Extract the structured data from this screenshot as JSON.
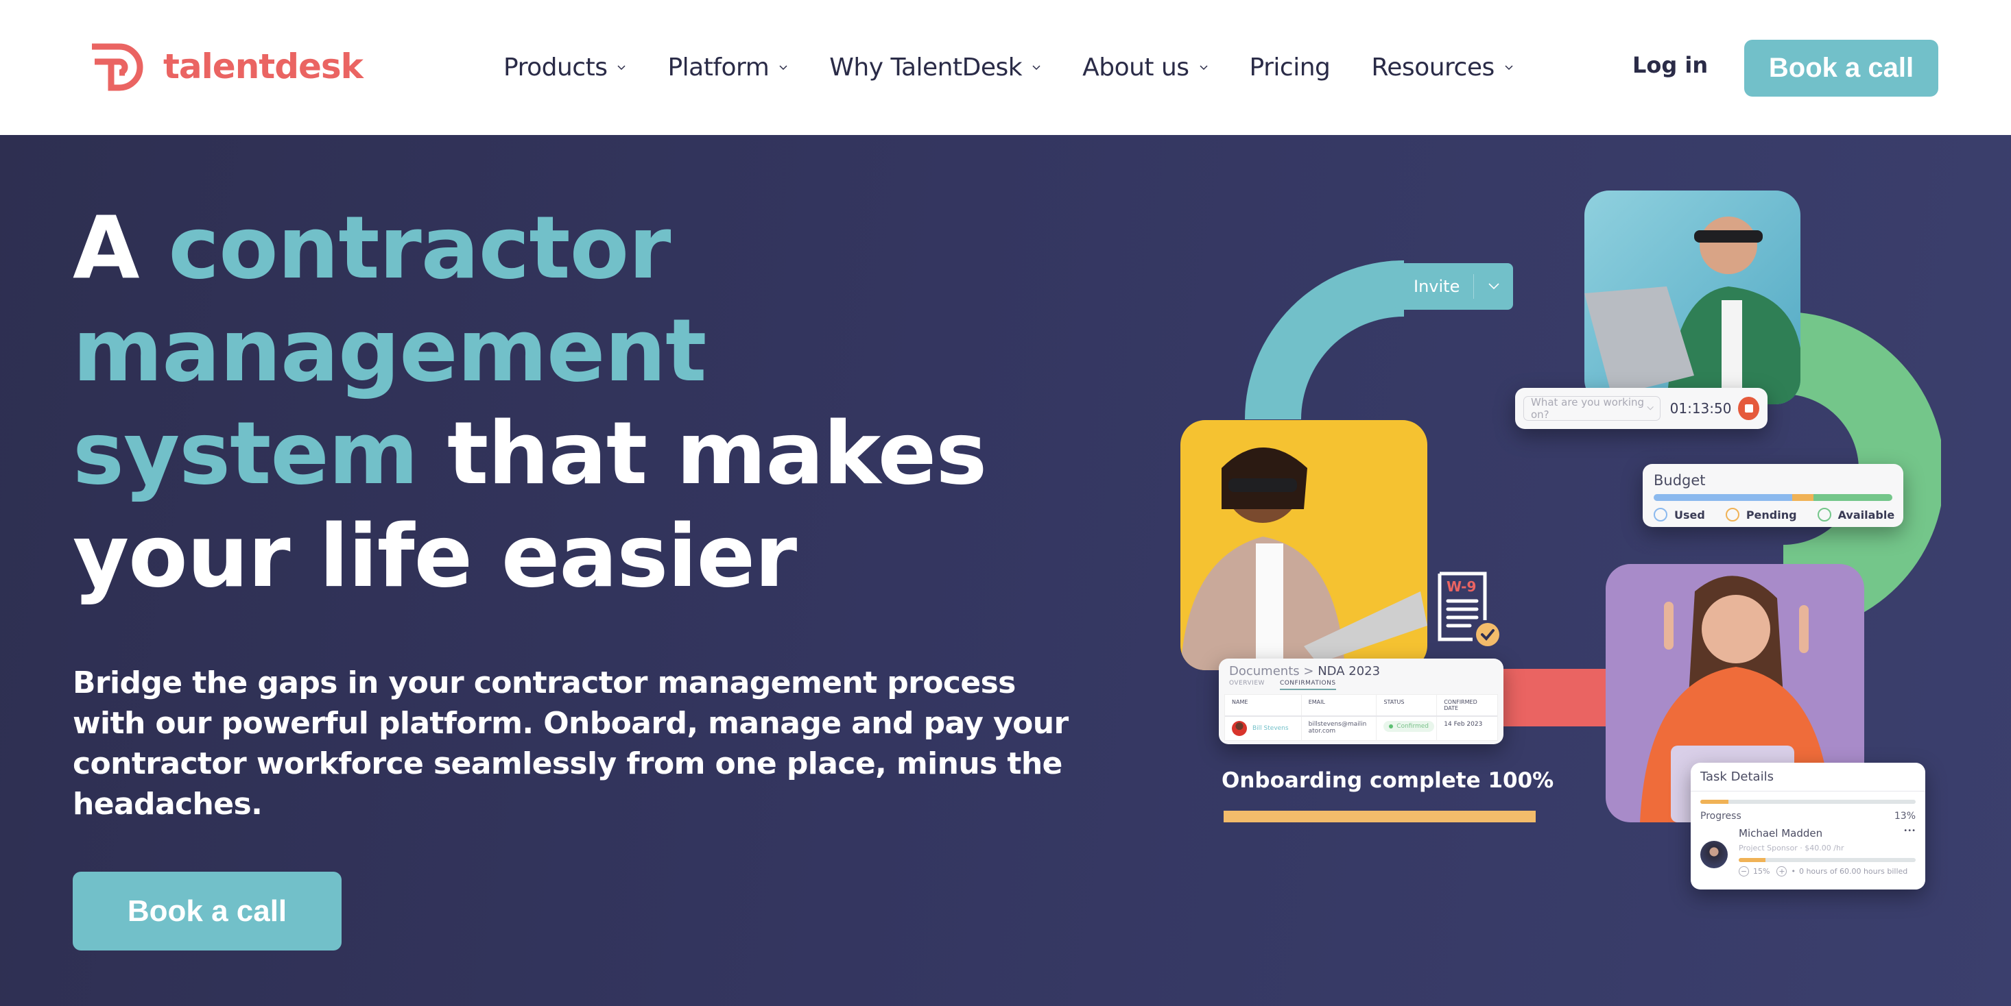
{
  "nav": {
    "logo_text": "talentdesk",
    "menu": [
      {
        "label": "Products",
        "has_dropdown": true
      },
      {
        "label": "Platform",
        "has_dropdown": true
      },
      {
        "label": "Why TalentDesk",
        "has_dropdown": true
      },
      {
        "label": "About us",
        "has_dropdown": true
      },
      {
        "label": "Pricing",
        "has_dropdown": false
      },
      {
        "label": "Resources",
        "has_dropdown": true
      }
    ],
    "login_label": "Log in",
    "cta_label": "Book a call"
  },
  "hero": {
    "headline_part1": "A ",
    "headline_accent": "contractor management system",
    "headline_part2": " that makes your life easier",
    "subheadline": "Bridge the gaps in your contractor management process with our powerful platform. Onboard, manage and pay your contractor workforce seamlessly from one place, minus the headaches.",
    "cta_label": "Book a call"
  },
  "illustration": {
    "invite_button": {
      "label": "Invite"
    },
    "timer": {
      "placeholder": "What are you working on?",
      "time": "01:13:50"
    },
    "budget": {
      "title": "Budget",
      "segments": [
        {
          "label": "Used",
          "fraction": 0.58,
          "color": "#8bb9ee"
        },
        {
          "label": "Pending",
          "fraction": 0.09,
          "color": "#f0b256"
        },
        {
          "label": "Available",
          "fraction": 0.33,
          "color": "#74c68a"
        }
      ]
    },
    "w9_label": "W-9",
    "documents": {
      "breadcrumb_parent": "Documents",
      "breadcrumb_sep": ">",
      "breadcrumb_current": "NDA 2023",
      "tabs": [
        {
          "label": "OVERVIEW",
          "active": false
        },
        {
          "label": "CONFIRMATIONS",
          "active": true
        }
      ],
      "columns": [
        "NAME",
        "EMAIL",
        "STATUS",
        "CONFIRMED DATE"
      ],
      "rows": [
        {
          "name": "Bill Stevens",
          "email": "billstevens@mailinator.com",
          "status": "Confirmed",
          "date": "14 Feb 2023"
        }
      ]
    },
    "onboarding": {
      "label": "Onboarding complete 100%",
      "progress_percent": 100
    },
    "task": {
      "title": "Task Details",
      "progress_label": "Progress",
      "progress_value": "13%",
      "progress_percent": 13,
      "person_name": "Michael Madden",
      "person_role": "Project Sponsor",
      "person_rate": "$40.00 /hr",
      "person_share": "15%",
      "person_share_percent": 15,
      "billed_text": "0 hours of 60.00 hours billed",
      "more_label": "•••"
    }
  },
  "colors": {
    "brand_red": "#ea6462",
    "teal": "#72c0c9",
    "navy": "#2f3052",
    "green": "#74c68a",
    "orange": "#f3bc6b",
    "purple": "#a88bc9",
    "yellow": "#f5c231"
  }
}
